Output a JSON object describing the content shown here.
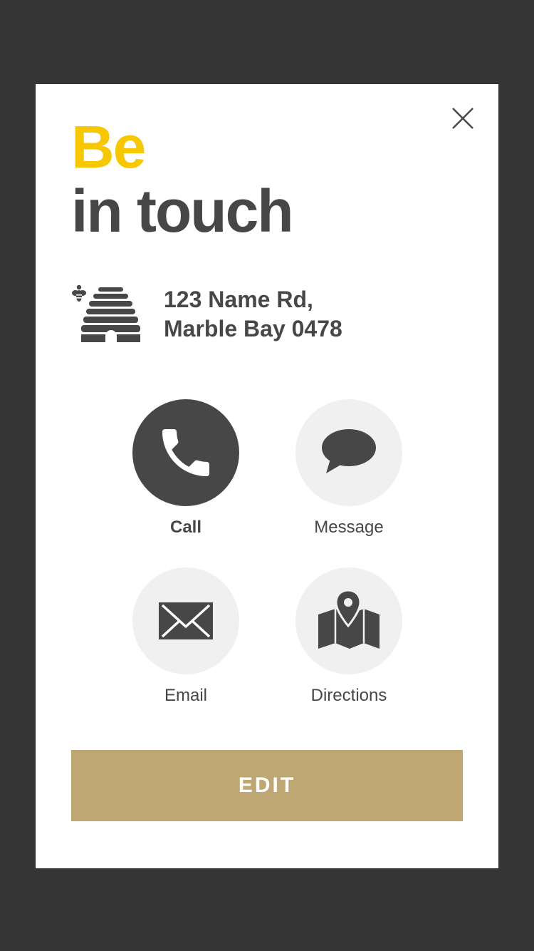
{
  "colors": {
    "accent": "#f7c800",
    "text": "#474747",
    "button": "#bea772",
    "backdrop": "#353535",
    "circle_active": "#474747",
    "circle_inactive": "#f0f0f0"
  },
  "header": {
    "title_accent": "Be",
    "title_main": "in touch",
    "close_icon": "close-icon"
  },
  "address": {
    "icon": "beehive-icon",
    "line1": "123 Name Rd,",
    "line2": "Marble Bay 0478"
  },
  "actions": [
    {
      "label": "Call",
      "icon": "phone-icon",
      "active": true
    },
    {
      "label": "Message",
      "icon": "speech-bubble-icon",
      "active": false
    },
    {
      "label": "Email",
      "icon": "envelope-icon",
      "active": false
    },
    {
      "label": "Directions",
      "icon": "map-pin-icon",
      "active": false
    }
  ],
  "edit_button": {
    "label": "EDIT"
  }
}
